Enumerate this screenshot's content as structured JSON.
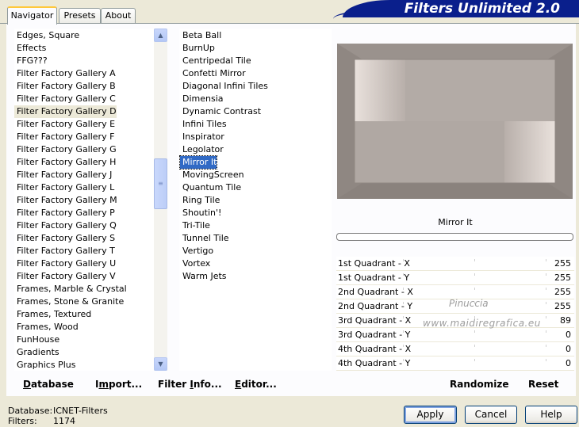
{
  "tabs": [
    "Navigator",
    "Presets",
    "About"
  ],
  "banner_title": "Filters Unlimited 2.0",
  "categories": [
    "Edges, Square",
    "Effects",
    "FFG???",
    "Filter Factory Gallery A",
    "Filter Factory Gallery B",
    "Filter Factory Gallery C",
    "Filter Factory Gallery D",
    "Filter Factory Gallery E",
    "Filter Factory Gallery F",
    "Filter Factory Gallery G",
    "Filter Factory Gallery H",
    "Filter Factory Gallery J",
    "Filter Factory Gallery L",
    "Filter Factory Gallery M",
    "Filter Factory Gallery P",
    "Filter Factory Gallery Q",
    "Filter Factory Gallery S",
    "Filter Factory Gallery T",
    "Filter Factory Gallery U",
    "Filter Factory Gallery V",
    "Frames, Marble & Crystal",
    "Frames, Stone & Granite",
    "Frames, Textured",
    "Frames, Wood",
    "FunHouse",
    "Gradients",
    "Graphics Plus"
  ],
  "selected_category": "Filter Factory Gallery D",
  "filters": [
    "Beta Ball",
    "BurnUp",
    "Centripedal Tile",
    "Confetti Mirror",
    "Diagonal Infini Tiles",
    "Dimensia",
    "Dynamic Contrast",
    "Infini Tiles",
    "Inspirator",
    "Legolator",
    "Mirror It",
    "MovingScreen",
    "Quantum Tile",
    "Ring Tile",
    "Shoutin'!",
    "Tri-Tile",
    "Tunnel Tile",
    "Vertigo",
    "Vortex",
    "Warm Jets"
  ],
  "selected_filter": "Mirror It",
  "preview_filter_name": "Mirror It",
  "sliders": [
    {
      "label": "1st Quadrant - X",
      "value": "255"
    },
    {
      "label": "1st Quadrant - Y",
      "value": "255"
    },
    {
      "label": "2nd Quadrant - X",
      "value": "255"
    },
    {
      "label": "2nd Quadrant - Y",
      "value": "255"
    },
    {
      "label": "3rd Quadrant - X",
      "value": "89"
    },
    {
      "label": "3rd Quadrant - Y",
      "value": "0"
    },
    {
      "label": "4th Quadrant - X",
      "value": "0"
    },
    {
      "label": "4th Quadrant - Y",
      "value": "0"
    }
  ],
  "watermark": {
    "line1": "Pinuccia",
    "line2": "www.maidiregrafica.eu"
  },
  "bottom_buttons": {
    "database": {
      "u": "D",
      "rest": "atabase"
    },
    "import": {
      "pre": "I",
      "u": "m",
      "rest": "port..."
    },
    "filter_info": {
      "pre": "Filter ",
      "u": "I",
      "rest": "nfo..."
    },
    "editor": {
      "u": "E",
      "rest": "ditor..."
    }
  },
  "randomize_label": "Randomize",
  "reset_label": "Reset",
  "status": {
    "database_label": "Database:",
    "database_value": "ICNET-Filters",
    "filters_label": "Filters:",
    "filters_value": "1174"
  },
  "dialog_buttons": {
    "apply": "Apply",
    "cancel": "Cancel",
    "help": "Help"
  },
  "colors": {
    "banner": "#0a1f8c",
    "selection": "#316ac5",
    "window": "#ece9d8"
  }
}
